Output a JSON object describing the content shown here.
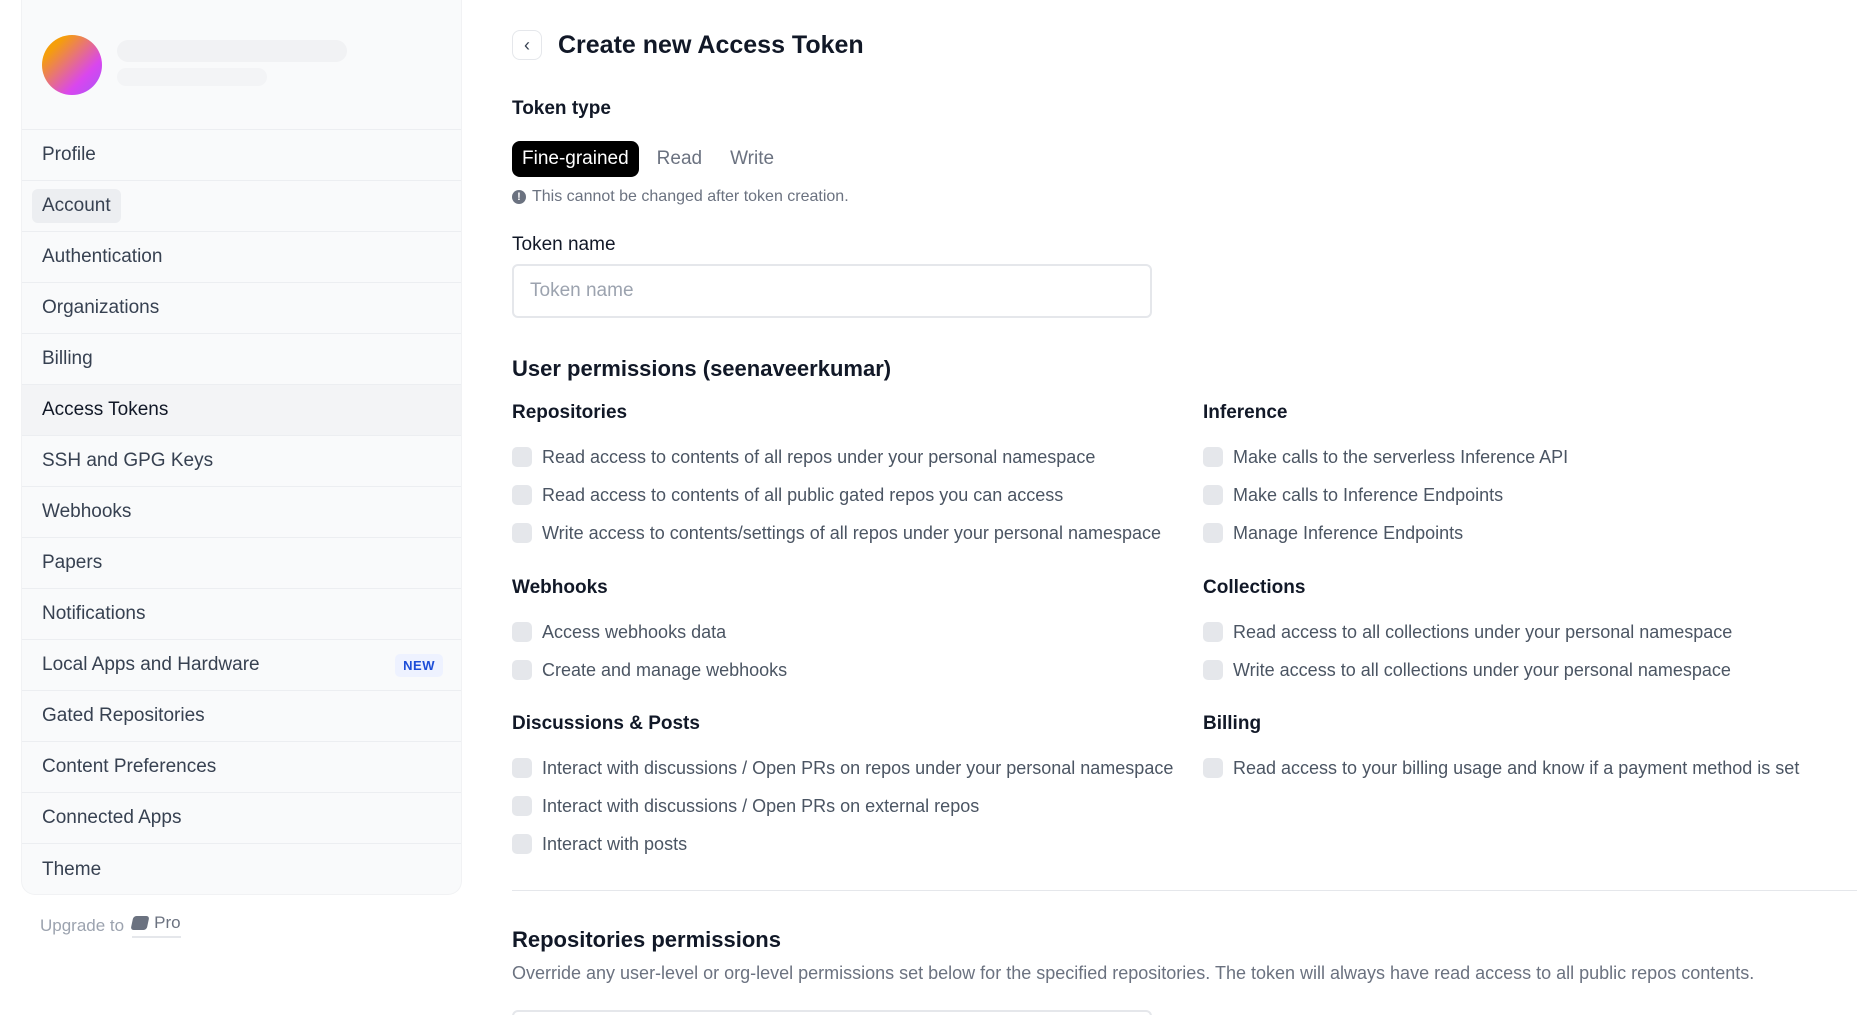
{
  "sidebar": {
    "items": [
      {
        "label": "Profile"
      },
      {
        "label": "Account"
      },
      {
        "label": "Authentication"
      },
      {
        "label": "Organizations"
      },
      {
        "label": "Billing"
      },
      {
        "label": "Access Tokens"
      },
      {
        "label": "SSH and GPG Keys"
      },
      {
        "label": "Webhooks"
      },
      {
        "label": "Papers"
      },
      {
        "label": "Notifications"
      },
      {
        "label": "Local Apps and Hardware",
        "badge": "NEW"
      },
      {
        "label": "Gated Repositories"
      },
      {
        "label": "Content Preferences"
      },
      {
        "label": "Connected Apps"
      },
      {
        "label": "Theme"
      }
    ],
    "active": "Access Tokens",
    "upgrade_text": "Upgrade to",
    "upgrade_plan": "Pro"
  },
  "header": {
    "back_icon": "chevron-left-icon",
    "title": "Create new Access Token"
  },
  "token_type": {
    "label": "Token type",
    "tabs": [
      "Fine-grained",
      "Read",
      "Write"
    ],
    "selected": "Fine-grained",
    "note": "This cannot be changed after token creation."
  },
  "token_name": {
    "label": "Token name",
    "placeholder": "Token name",
    "value": ""
  },
  "user_permissions": {
    "title": "User permissions (seenaveerkumar)",
    "groups": {
      "repositories": {
        "title": "Repositories",
        "items": [
          "Read access to contents of all repos under your personal namespace",
          "Read access to contents of all public gated repos you can access",
          "Write access to contents/settings of all repos under your personal namespace"
        ]
      },
      "inference": {
        "title": "Inference",
        "items": [
          "Make calls to the serverless Inference API",
          "Make calls to Inference Endpoints",
          "Manage Inference Endpoints"
        ]
      },
      "webhooks": {
        "title": "Webhooks",
        "items": [
          "Access webhooks data",
          "Create and manage webhooks"
        ]
      },
      "collections": {
        "title": "Collections",
        "items": [
          "Read access to all collections under your personal namespace",
          "Write access to all collections under your personal namespace"
        ]
      },
      "discussions": {
        "title": "Discussions & Posts",
        "items": [
          "Interact with discussions / Open PRs on repos under your personal namespace",
          "Interact with discussions / Open PRs on external repos",
          "Interact with posts"
        ]
      },
      "billing": {
        "title": "Billing",
        "items": [
          "Read access to your billing usage and know if a payment method is set"
        ]
      }
    }
  },
  "repositories_permissions": {
    "title": "Repositories permissions",
    "description": "Override any user-level or org-level permissions set below for the specified repositories. The token will always have read access to all public repos contents."
  },
  "colors": {
    "accent_selected_tab": "#000000",
    "badge_new": "#1d4ed8"
  }
}
